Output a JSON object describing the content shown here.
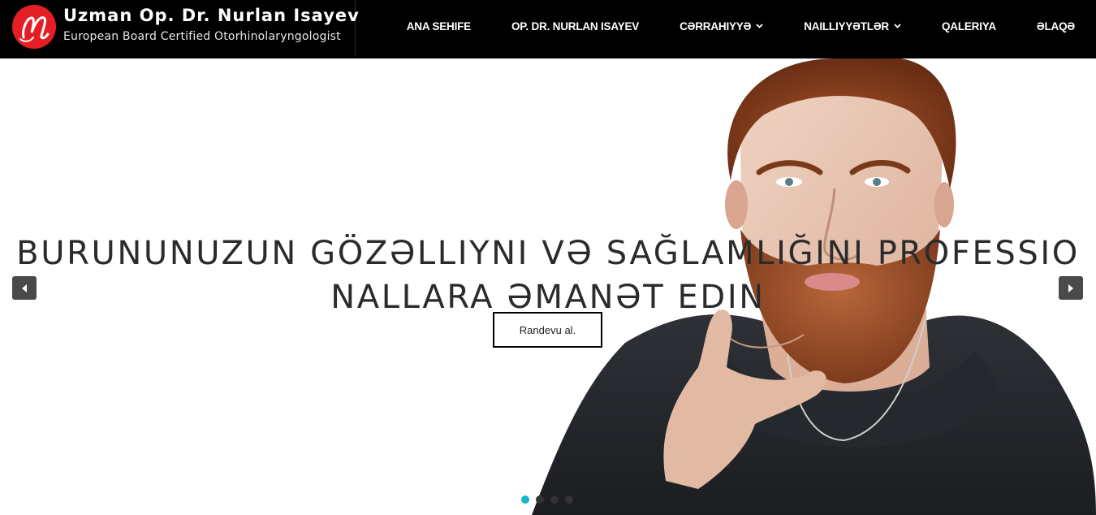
{
  "brand": {
    "title": "Uzman Op. Dr. Nurlan Isayev",
    "subtitle": "European Board Certified Otorhinolaryngologist",
    "logo_letter": "N",
    "logo_color": "#e31e24"
  },
  "nav": {
    "items": [
      {
        "label": "ANA SEHIFE",
        "has_dropdown": false
      },
      {
        "label": "OP. DR. NURLAN ISAYEV",
        "has_dropdown": false
      },
      {
        "label": "CƏRRAHIYYƏ",
        "has_dropdown": true,
        "icon": "chevron-down-icon"
      },
      {
        "label": "NAILLIYYƏTLƏR",
        "has_dropdown": true,
        "icon": "chevron-down-icon"
      },
      {
        "label": "QALERIYA",
        "has_dropdown": false
      },
      {
        "label": "ƏLAQƏ",
        "has_dropdown": false
      }
    ]
  },
  "hero": {
    "headline_line1": "BURUNUNUZUN GÖZƏLLIYNI VƏ SAĞLAMLIĞINI PROFESSIO",
    "headline_line2": "NALLARA ƏMANƏT EDIN",
    "cta_label": "Randevu al.",
    "prev_icon": "caret-left-icon",
    "next_icon": "caret-right-icon",
    "slides_total": 4,
    "active_slide": 1,
    "active_dot_color": "#17b6c6"
  }
}
